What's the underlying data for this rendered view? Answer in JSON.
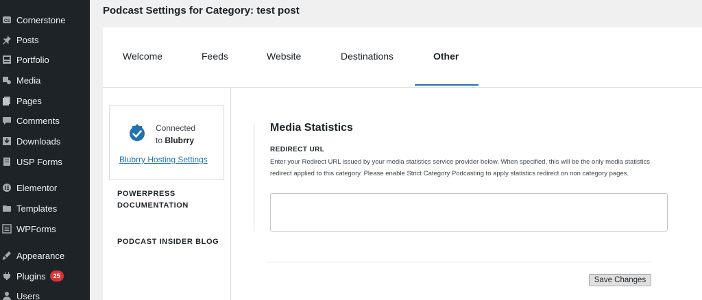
{
  "sidebar": {
    "items": [
      {
        "label": "Cornerstone",
        "icon": "cornerstone-icon",
        "glyph": "CS"
      },
      {
        "label": "Posts",
        "icon": "pin-icon"
      },
      {
        "label": "Portfolio",
        "icon": "portfolio-icon"
      },
      {
        "label": "Media",
        "icon": "media-icon"
      },
      {
        "label": "Pages",
        "icon": "pages-icon"
      },
      {
        "label": "Comments",
        "icon": "comments-icon"
      },
      {
        "label": "Downloads",
        "icon": "downloads-icon"
      },
      {
        "label": "USP Forms",
        "icon": "forms-icon"
      },
      {
        "label": "Elementor",
        "icon": "elementor-icon"
      },
      {
        "label": "Templates",
        "icon": "templates-icon"
      },
      {
        "label": "WPForms",
        "icon": "wpforms-icon"
      },
      {
        "label": "Appearance",
        "icon": "appearance-icon"
      },
      {
        "label": "Plugins",
        "icon": "plugins-icon",
        "badge": "25"
      },
      {
        "label": "Users",
        "icon": "users-icon"
      }
    ]
  },
  "header": {
    "title": "Podcast Settings for Category: test post"
  },
  "tabs": [
    {
      "label": "Welcome"
    },
    {
      "label": "Feeds"
    },
    {
      "label": "Website"
    },
    {
      "label": "Destinations"
    },
    {
      "label": "Other",
      "active": true
    }
  ],
  "connection": {
    "line1": "Connected",
    "line2_prefix": "to ",
    "line2_bold": "Blubrry",
    "link": "Blubrry Hosting Settings"
  },
  "side_links": {
    "doc_line1": "POWERPRESS",
    "doc_line2": "DOCUMENTATION",
    "blog": "PODCAST INSIDER BLOG"
  },
  "section": {
    "title": "Media Statistics",
    "field_label": "REDIRECT URL",
    "description": "Enter your Redirect URL issued by your media statistics service provider below. When specified, this will be the only media statistics redirect applied to this category. Please enable Strict Category Podcasting to apply statistics redirect on non category pages.",
    "input_value": ""
  },
  "actions": {
    "save": "Save Changes"
  },
  "colors": {
    "sidebar_bg": "#1d2327",
    "accent": "#2271b1",
    "badge": "#d63638"
  }
}
